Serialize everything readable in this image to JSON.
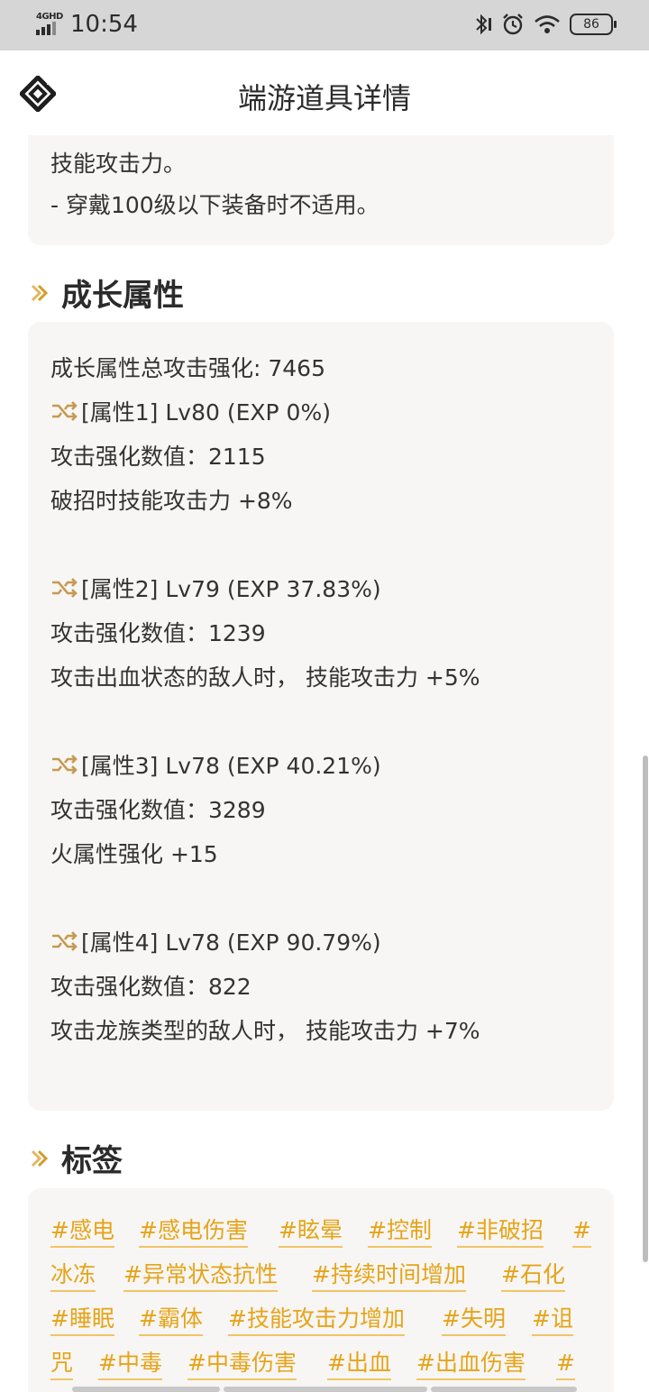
{
  "status_bar": {
    "network": "4GHD",
    "time": "10:54",
    "battery": "86"
  },
  "app_bar": {
    "title": "端游道具详情"
  },
  "description": {
    "lines": [
      "技能攻击力。",
      "- 穿戴100级以下装备时不适用。"
    ]
  },
  "growth": {
    "heading": "成长属性",
    "total": "成长属性总攻击强化: 7465",
    "attributes": [
      {
        "header": "[属性1] Lv80 (EXP 0%)",
        "value": "攻击强化数值：2115",
        "effect": "破招时技能攻击力 +8%"
      },
      {
        "header": "[属性2] Lv79 (EXP 37.83%)",
        "value": "攻击强化数值：1239",
        "effect": "攻击出血状态的敌人时， 技能攻击力 +5%"
      },
      {
        "header": "[属性3] Lv78 (EXP 40.21%)",
        "value": "攻击强化数值：3289",
        "effect": "火属性强化 +15"
      },
      {
        "header": "[属性4] Lv78 (EXP 90.79%)",
        "value": "攻击强化数值：822",
        "effect": "攻击龙族类型的敌人时， 技能攻击力 +7%"
      }
    ]
  },
  "tags": {
    "heading": "标签",
    "rows": [
      [
        "#感电",
        "#感电伤害",
        "#眩晕",
        "#控制",
        "#非破招",
        "#"
      ],
      [
        "冰冻",
        "#异常状态抗性",
        "#持续时间增加",
        "#石化"
      ],
      [
        "#睡眠",
        "#霸体",
        "#技能攻击力增加",
        "#失明",
        "#诅"
      ],
      [
        "咒",
        "#中毒",
        "#中毒伤害",
        "#出血",
        "#出血伤害",
        "#"
      ]
    ]
  },
  "colors": {
    "accent": "#e5a41a",
    "card_bg": "#f8f6f4",
    "status_bar_bg": "#d6d6d6"
  }
}
